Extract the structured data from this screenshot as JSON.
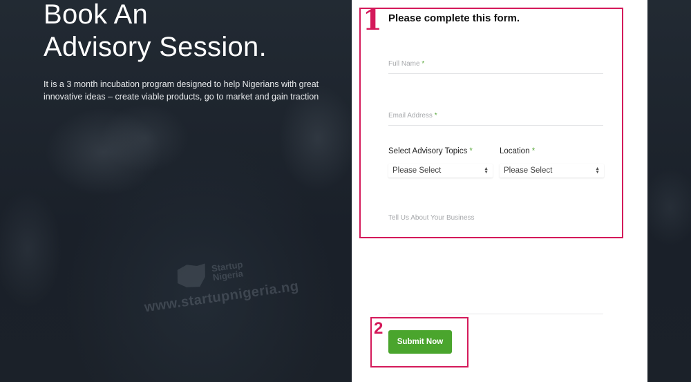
{
  "hero": {
    "title_line1": "Book An",
    "title_line2": "Advisory Session.",
    "description": "It is a 3 month incubation program designed to help Nigerians with great innovative ideas – create viable products, go to market and gain traction"
  },
  "watermark": {
    "brand_line1": "Startup",
    "brand_line2": "Nigeria",
    "url": "www.startupnigeria.ng"
  },
  "form": {
    "title": "Please complete this form.",
    "full_name_label": "Full Name",
    "email_label": "Email Address",
    "required_marker": "*",
    "topics_label": "Select Advisory Topics",
    "topics_value": "Please Select",
    "location_label": "Location",
    "location_value": "Please Select",
    "business_label": "Tell Us About Your Business",
    "submit_label": "Submit Now"
  },
  "annotations": [
    {
      "number": "1",
      "target": "form fields"
    },
    {
      "number": "2",
      "target": "submit button"
    }
  ],
  "colors": {
    "annotation": "#d4195a",
    "submit_button": "#4aa52d",
    "required_marker": "#5aa83c",
    "background": "#1b222b"
  }
}
